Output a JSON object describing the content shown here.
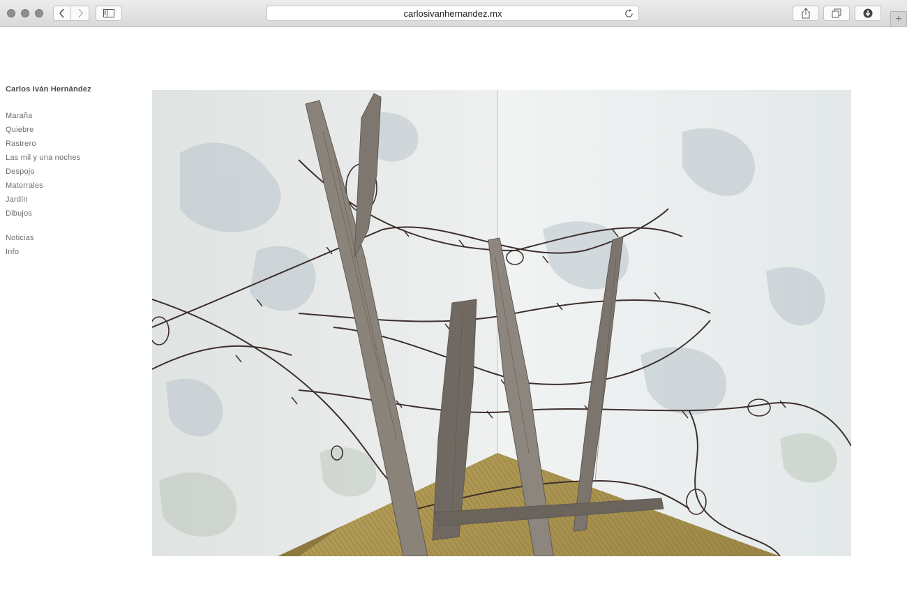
{
  "browser": {
    "url": "carlosivanhernandez.mx",
    "new_tab_label": "+"
  },
  "site": {
    "title": "Carlos Iván Hernández",
    "nav_primary": [
      "Maraña",
      "Quiebre",
      "Rastrero",
      "Las mil y una noches",
      "Despojo",
      "Matorrales",
      "Jardín",
      "Dibujos"
    ],
    "nav_secondary": [
      "Noticias",
      "Info"
    ]
  },
  "colors": {
    "wall": "#e8ecec",
    "floor": "#a48f4d",
    "wood": "#7c766e",
    "wire": "#3d2f2c"
  }
}
